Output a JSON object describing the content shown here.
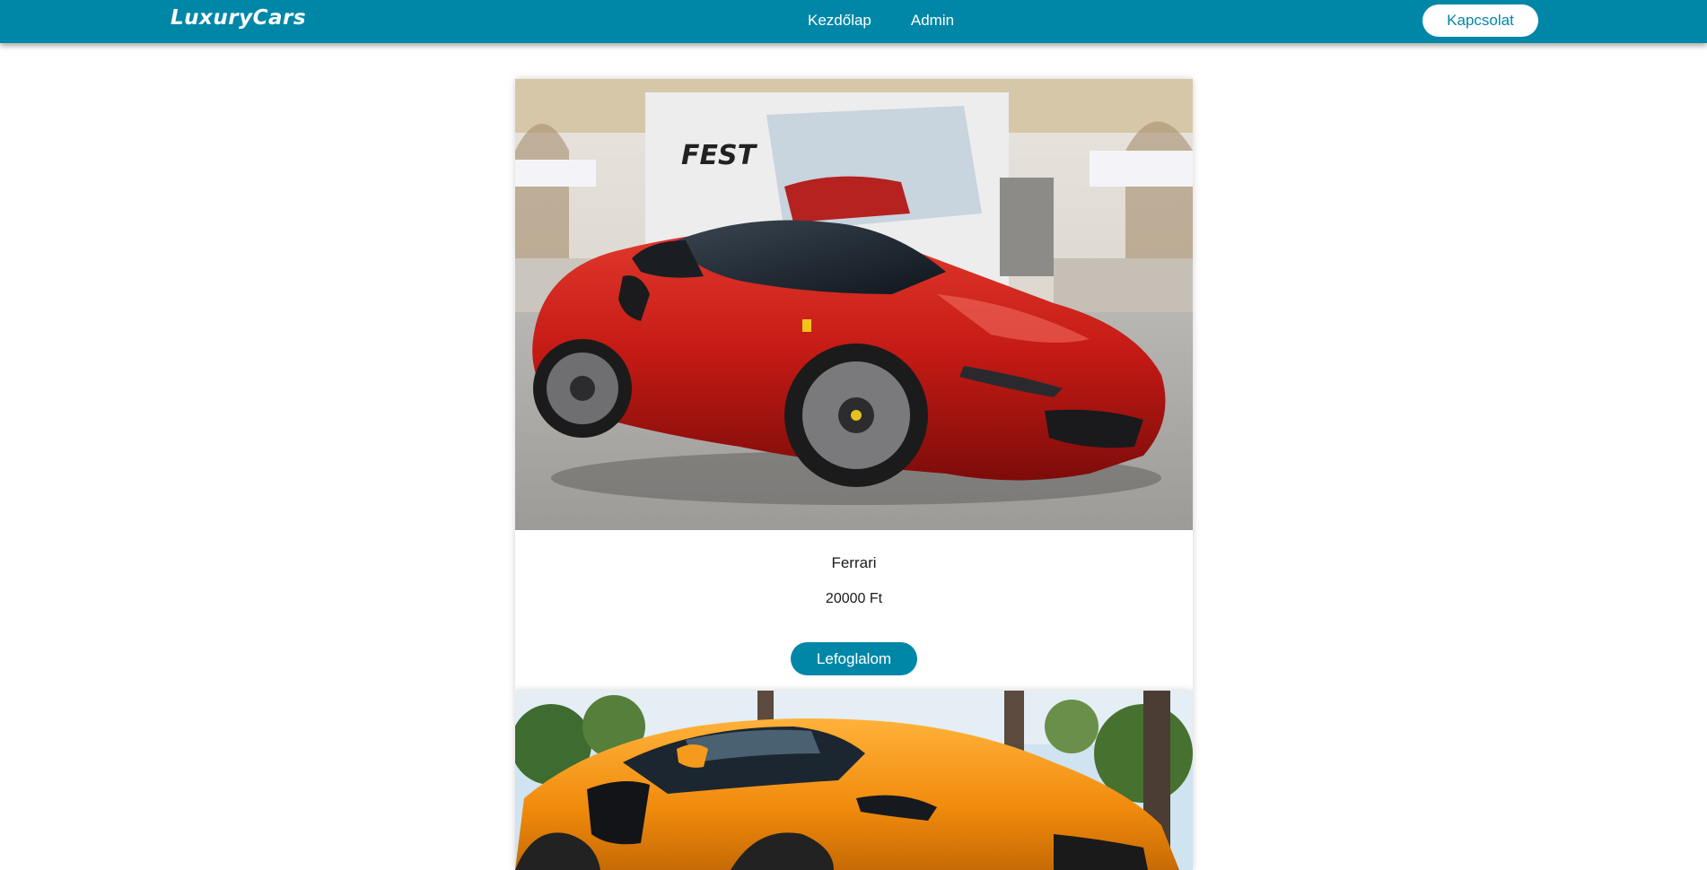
{
  "nav": {
    "logo": "LuxuryCars",
    "links": [
      "Kezdőlap",
      "Admin"
    ],
    "contact_label": "Kapcsolat"
  },
  "cars": [
    {
      "name": "Ferrari",
      "price": "20000 Ft",
      "button_label": "Lefoglalom",
      "image_desc": "red-ferrari-photo"
    },
    {
      "image_desc": "orange-mclaren-photo"
    }
  ],
  "colors": {
    "primary": "#0087a8",
    "background": "#ffffff"
  }
}
